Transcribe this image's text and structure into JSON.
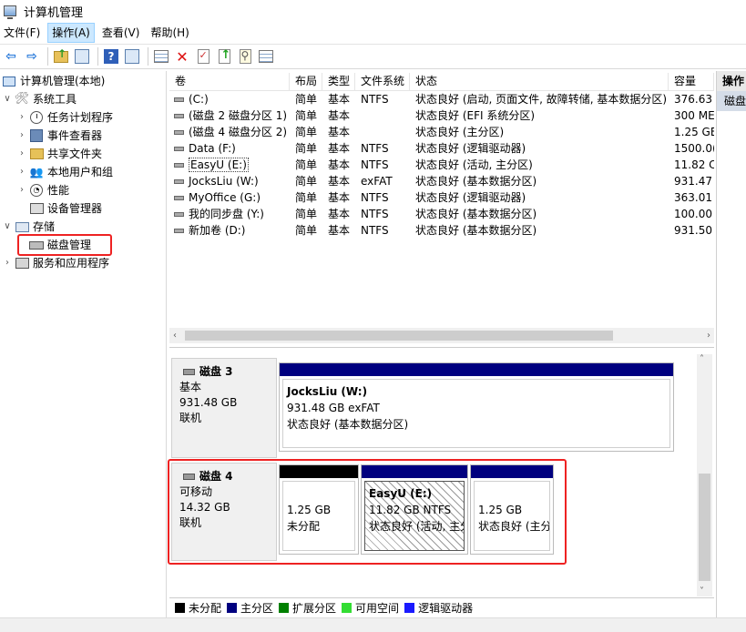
{
  "window": {
    "title": "计算机管理"
  },
  "menu": [
    "文件(F)",
    "操作(A)",
    "查看(V)",
    "帮助(H)"
  ],
  "toolbar_icons": [
    "back-arrow-icon",
    "forward-arrow-icon",
    "up-folder-icon",
    "show-hide-tree-icon",
    "help-icon",
    "console-icon",
    "connect-icon",
    "delete-icon",
    "properties-icon",
    "import-icon",
    "find-icon",
    "list-view-icon"
  ],
  "tree": {
    "root": "计算机管理(本地)",
    "system_tools": "系统工具",
    "task_scheduler": "任务计划程序",
    "event_viewer": "事件查看器",
    "shared_folders": "共享文件夹",
    "local_users": "本地用户和组",
    "performance": "性能",
    "device_manager": "设备管理器",
    "storage": "存储",
    "disk_management": "磁盘管理",
    "services_apps": "服务和应用程序"
  },
  "volume_table": {
    "headers": [
      "卷",
      "布局",
      "类型",
      "文件系统",
      "状态",
      "容量"
    ],
    "rows": [
      [
        "(C:)",
        "简单",
        "基本",
        "NTFS",
        "状态良好 (启动, 页面文件, 故障转储, 基本数据分区)",
        "376.63"
      ],
      [
        "(磁盘 2 磁盘分区 1)",
        "简单",
        "基本",
        "",
        "状态良好 (EFI 系统分区)",
        "300 ME"
      ],
      [
        "(磁盘 4 磁盘分区 2)",
        "简单",
        "基本",
        "",
        "状态良好 (主分区)",
        "1.25 GE"
      ],
      [
        "Data (F:)",
        "简单",
        "基本",
        "NTFS",
        "状态良好 (逻辑驱动器)",
        "1500.0("
      ],
      [
        "EasyU (E:)",
        "简单",
        "基本",
        "NTFS",
        "状态良好 (活动, 主分区)",
        "11.82 C"
      ],
      [
        "JocksLiu (W:)",
        "简单",
        "基本",
        "exFAT",
        "状态良好 (基本数据分区)",
        "931.47"
      ],
      [
        "MyOffice (G:)",
        "简单",
        "基本",
        "NTFS",
        "状态良好 (逻辑驱动器)",
        "363.01"
      ],
      [
        "我的同步盘 (Y:)",
        "简单",
        "基本",
        "NTFS",
        "状态良好 (基本数据分区)",
        "100.00"
      ],
      [
        "新加卷 (D:)",
        "简单",
        "基本",
        "NTFS",
        "状态良好 (基本数据分区)",
        "931.50"
      ]
    ]
  },
  "disk3": {
    "name": "磁盘 3",
    "type": "基本",
    "size": "931.48 GB",
    "status": "联机",
    "partition": {
      "name": "JocksLiu  (W:)",
      "size": "931.48 GB exFAT",
      "status": "状态良好 (基本数据分区)"
    }
  },
  "disk4": {
    "name": "磁盘 4",
    "type": "可移动",
    "size": "14.32 GB",
    "status": "联机",
    "partitions": [
      {
        "name": "",
        "size": "1.25 GB",
        "status": "未分配"
      },
      {
        "name": "EasyU  (E:)",
        "size": "11.82 GB NTFS",
        "status": "状态良好 (活动, 主分"
      },
      {
        "name": "",
        "size": "1.25 GB",
        "status": "状态良好 (主分"
      }
    ]
  },
  "legend": [
    {
      "label": "未分配",
      "color": "#000000"
    },
    {
      "label": "主分区",
      "color": "#00007f"
    },
    {
      "label": "扩展分区",
      "color": "#008000"
    },
    {
      "label": "可用空间",
      "color": "#33dd33"
    },
    {
      "label": "逻辑驱动器",
      "color": "#1a1aff"
    }
  ],
  "actions": {
    "header": "操作",
    "item": "磁盘"
  },
  "colors": {
    "primary_partition": "#00007f",
    "unallocated": "#000000",
    "highlight_box": "#e22222",
    "menu_active": "#cce8ff"
  }
}
